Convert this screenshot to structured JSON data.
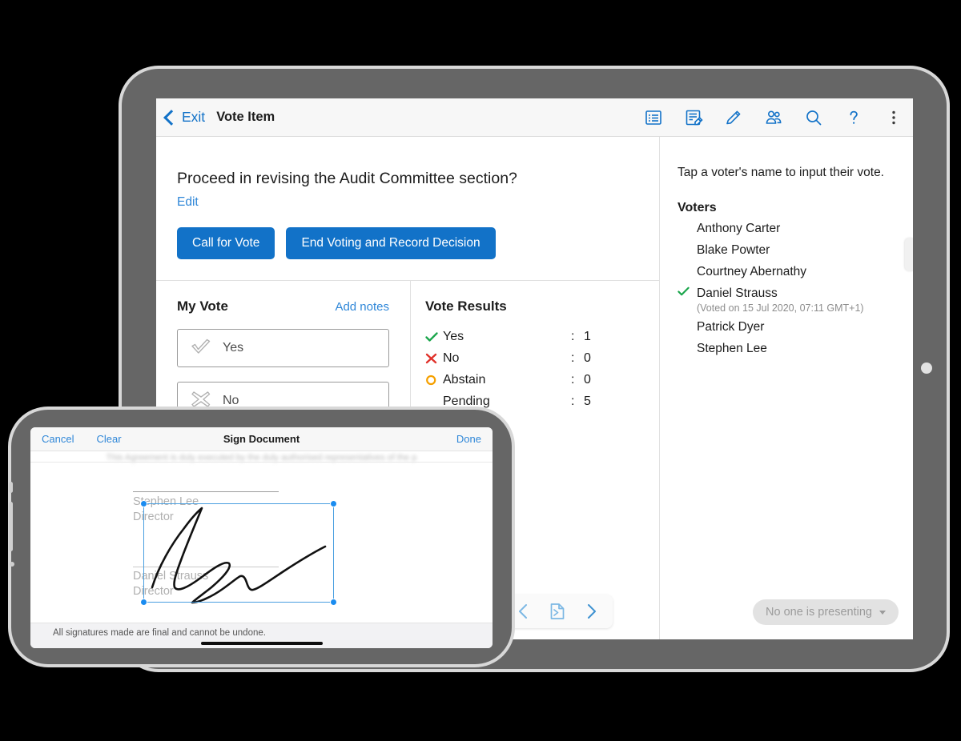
{
  "tablet": {
    "navbar": {
      "back_label": "Exit",
      "title": "Vote Item",
      "icons": [
        {
          "name": "agenda-list-icon",
          "title": "Agenda"
        },
        {
          "name": "minutes-document-icon",
          "title": "Minutes"
        },
        {
          "name": "pencil-annotate-icon",
          "title": "Annotate"
        },
        {
          "name": "people-icon",
          "title": "Participants"
        },
        {
          "name": "search-icon",
          "title": "Search"
        },
        {
          "name": "help-icon",
          "title": "Help"
        },
        {
          "name": "more-menu-icon",
          "title": "More"
        }
      ]
    },
    "vote_item": {
      "question": "Proceed in revising the Audit Committee section?",
      "edit_label": "Edit",
      "call_for_vote_label": "Call for Vote",
      "end_voting_label": "End Voting and Record Decision"
    },
    "my_vote": {
      "title": "My Vote",
      "add_notes_label": "Add notes",
      "options": [
        {
          "label": "Yes",
          "icon": "check-outline-icon"
        },
        {
          "label": "No",
          "icon": "cross-outline-icon"
        }
      ]
    },
    "vote_results": {
      "title": "Vote Results",
      "rows": [
        {
          "label": "Yes",
          "icon": "check-icon",
          "color": "#1aa54b",
          "separator": ":",
          "count": "1"
        },
        {
          "label": "No",
          "icon": "cross-icon",
          "color": "#e0322b",
          "separator": ":",
          "count": "0"
        },
        {
          "label": "Abstain",
          "icon": "circle-outline-icon",
          "color": "#f5a000",
          "separator": ":",
          "count": "0"
        },
        {
          "label": "Pending",
          "icon": "none",
          "color": "#1c1c1c",
          "separator": ":",
          "count": "5"
        }
      ]
    },
    "voters_panel": {
      "hint": "Tap a voter's name to input their vote.",
      "section_title": "Voters",
      "voters": [
        {
          "name": "Anthony Carter",
          "voted": false,
          "detail": ""
        },
        {
          "name": "Blake Powter",
          "voted": false,
          "detail": ""
        },
        {
          "name": "Courtney Abernathy",
          "voted": false,
          "detail": ""
        },
        {
          "name": "Daniel Strauss",
          "voted": true,
          "detail": "(Voted on 15 Jul 2020, 07:11 GMT+1)"
        },
        {
          "name": "Patrick Dyer",
          "voted": false,
          "detail": ""
        },
        {
          "name": "Stephen Lee",
          "voted": false,
          "detail": ""
        }
      ]
    },
    "bottom_bar": {
      "prev_icon": "previous-page-icon",
      "page_icon": "document-page-icon",
      "next_icon": "next-page-icon",
      "presenting_label": "No one is presenting"
    }
  },
  "phone": {
    "header": {
      "cancel_label": "Cancel",
      "clear_label": "Clear",
      "title": "Sign Document",
      "done_label": "Done"
    },
    "document": {
      "blurred_line": "This Agreement is duly executed by the duly authorised representatives of the p",
      "signature_blocks": [
        {
          "name": "Stephen Lee",
          "role": "Director"
        },
        {
          "name": "Daniel Strauss",
          "role": "Director"
        }
      ]
    },
    "footer_note": "All signatures made are final and cannot be undone."
  },
  "colors": {
    "accent_blue": "#1272c8",
    "link_blue": "#2f87d8",
    "success_green": "#1aa54b",
    "error_red": "#e0322b",
    "warning_orange": "#f5a000",
    "device_frame": "#666666"
  }
}
